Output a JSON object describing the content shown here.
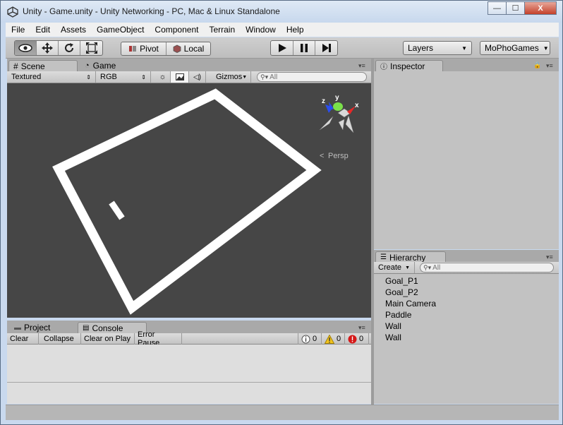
{
  "window": {
    "title": "Unity - Game.unity - Unity Networking - PC, Mac & Linux Standalone",
    "minimize_glyph": "—",
    "maximize_glyph": "☐",
    "close_glyph": "X"
  },
  "menu": [
    "File",
    "Edit",
    "Assets",
    "GameObject",
    "Component",
    "Terrain",
    "Window",
    "Help"
  ],
  "toolbar": {
    "pivot_label": "Pivot",
    "local_label": "Local",
    "layers_label": "Layers",
    "account_label": "MoPhoGames"
  },
  "scene_panel": {
    "tabs": [
      "Scene",
      "Game"
    ],
    "render_mode": "Textured",
    "color_mode": "RGB",
    "gizmos_label": "Gizmos",
    "search_placeholder": "All",
    "persp_label": "Persp",
    "axis_x": "x",
    "axis_y": "y",
    "axis_z": "z"
  },
  "inspector": {
    "tab_label": "Inspector"
  },
  "hierarchy": {
    "tab_label": "Hierarchy",
    "create_label": "Create",
    "search_placeholder": "All",
    "items": [
      "Goal_P1",
      "Goal_P2",
      "Main Camera",
      "Paddle",
      "Wall",
      "Wall"
    ]
  },
  "bottom_panel": {
    "tabs": [
      "Project",
      "Console"
    ],
    "buttons": [
      "Clear",
      "Collapse",
      "Clear on Play",
      "Error Pause"
    ],
    "info_count": "0",
    "warning_count": "0",
    "error_count": "0"
  },
  "colors": {
    "viewport_bg": "#464646",
    "panel_bg": "#c2c2c2",
    "title_bg": "#c9d9ee",
    "close_red": "#c4412a"
  }
}
